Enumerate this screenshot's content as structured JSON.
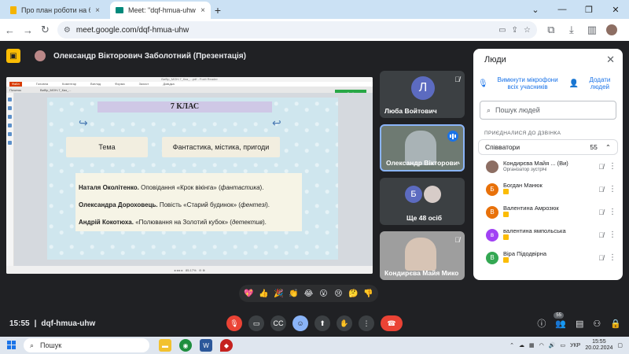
{
  "browser": {
    "tabs": [
      {
        "label": "Про план роботи на березень"
      },
      {
        "label": "Meet: \"dqf-hmua-uhw\""
      }
    ],
    "url": "meet.google.com/dqf-hmua-uhw",
    "new_tab": "+",
    "close": "×"
  },
  "meet": {
    "presenter": "Олександр Вікторович Заболотний (Презентація)",
    "meeting_code": "dqf-hmua-uhw",
    "time": "15:55",
    "separator": "|"
  },
  "slide": {
    "title": "7 КЛАС",
    "box_left": "Тема",
    "box_right": "Фантастика, містика, пригоди",
    "lines": [
      {
        "author": "Наталя Околітенко.",
        "text": " Оповідання «Крок вікінга» (",
        "genre": "фантастика",
        "end": ")."
      },
      {
        "author": "Олександра Дороховець.",
        "text": " Повість «Старий будинок» (",
        "genre": "фентезі",
        "end": ")."
      },
      {
        "author": "Андрій Кокотюха.",
        "text": " «Полювання на Золотий кубок» (",
        "genre": "детектив",
        "end": ")."
      }
    ]
  },
  "tiles": [
    {
      "name": "Люба Войтович",
      "initial": "Л"
    },
    {
      "name": "Олександр Вікторович Заболотний"
    },
    {
      "name": "Ще 48 осіб",
      "initial": "Б"
    },
    {
      "name": "Кондирєва Майя Микола..."
    }
  ],
  "people_panel": {
    "title": "Люди",
    "mute_all": "Вимкнути мікрофони всіх учасників",
    "add_people": "Додати людей",
    "search_placeholder": "Пошук людей",
    "section": "ПРИЄДНАЛИСЯ ДО ДЗВІНКА",
    "group_label": "Співватори",
    "group_count": "55",
    "participants": [
      {
        "name": "Кондирєва Майя ...",
        "tag": "(Ви)",
        "sub": "Організатор зустрічі",
        "initial": "",
        "color": "#8d6e63"
      },
      {
        "name": "Богдан Манюк",
        "initial": "Б",
        "color": "#e8710a"
      },
      {
        "name": "Валентина Амрозюк",
        "initial": "В",
        "color": "#e8710a"
      },
      {
        "name": "валентина ямпольська",
        "initial": "в",
        "color": "#a142f4"
      },
      {
        "name": "Віра Підодвірна",
        "initial": "В",
        "color": "#34a853"
      }
    ]
  },
  "reactions": [
    "💖",
    "👍",
    "🎉",
    "👏",
    "😂",
    "😮",
    "😢",
    "🤔",
    "👎"
  ],
  "controls": {
    "people_count": "55"
  },
  "taskbar": {
    "search": "Пошук",
    "lang": "УКР",
    "time": "15:55",
    "date": "20.02.2024"
  },
  "colors": {
    "accent": "#1a73e8",
    "end_call": "#ea4335",
    "presenting": "#fbbc04"
  }
}
